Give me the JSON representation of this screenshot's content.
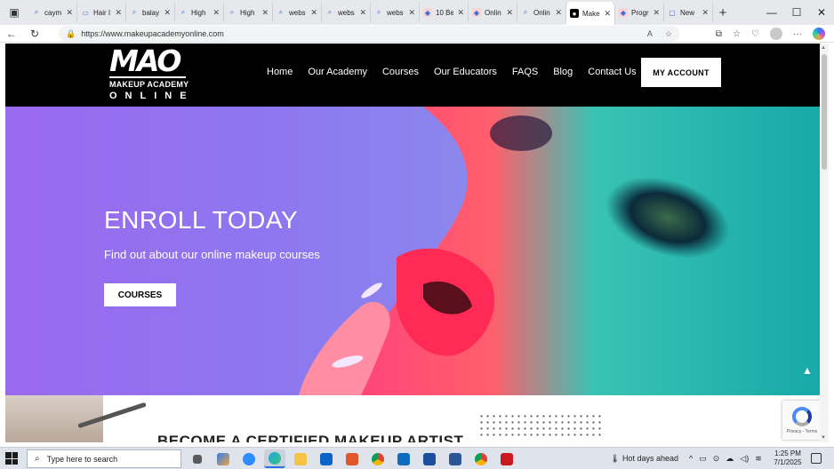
{
  "browser": {
    "tabs": [
      {
        "label": "caym",
        "icon": "search-icon"
      },
      {
        "label": "Hair I",
        "icon": "page-icon"
      },
      {
        "label": "balay",
        "icon": "search-icon"
      },
      {
        "label": "High",
        "icon": "search-icon"
      },
      {
        "label": "High",
        "icon": "search-icon"
      },
      {
        "label": "webs",
        "icon": "search-icon"
      },
      {
        "label": "webs",
        "icon": "search-icon"
      },
      {
        "label": "webs",
        "icon": "search-icon"
      },
      {
        "label": "10 Be",
        "icon": "site-icon"
      },
      {
        "label": "Onlin",
        "icon": "site-icon"
      },
      {
        "label": "Onlin",
        "icon": "search-icon"
      },
      {
        "label": "Make",
        "icon": "mao-icon",
        "active": true
      },
      {
        "label": "Progr",
        "icon": "site-icon"
      },
      {
        "label": "New",
        "icon": "newtab-icon"
      }
    ],
    "new_tab_symbol": "+",
    "url": "https://www.makeupacademyonline.com"
  },
  "site": {
    "logo": {
      "big": "MAO",
      "line2": "MAKEUP ACADEMY",
      "line3": "ONLINE"
    },
    "menu": [
      "Home",
      "Our Academy",
      "Courses",
      "Our Educators",
      "FAQS",
      "Blog",
      "Contact Us"
    ],
    "account_button": "MY ACCOUNT",
    "hero": {
      "title": "ENROLL TODAY",
      "subtitle": "Find out about our online makeup courses",
      "button": "COURSES"
    },
    "section_heading": "BECOME A CERTIFIED MAKEUP ARTIST",
    "recaptcha_terms": "Privacy - Terms"
  },
  "taskbar": {
    "search_placeholder": "Type here to search",
    "weather": "Hot days ahead",
    "time": "1:25 PM",
    "date": "7/1/2025"
  },
  "colors": {
    "nav_bg": "#000000",
    "hero_left": "#9a69ee",
    "hero_right": "#2bb8c0",
    "taskbar": "#dfe4ec"
  }
}
